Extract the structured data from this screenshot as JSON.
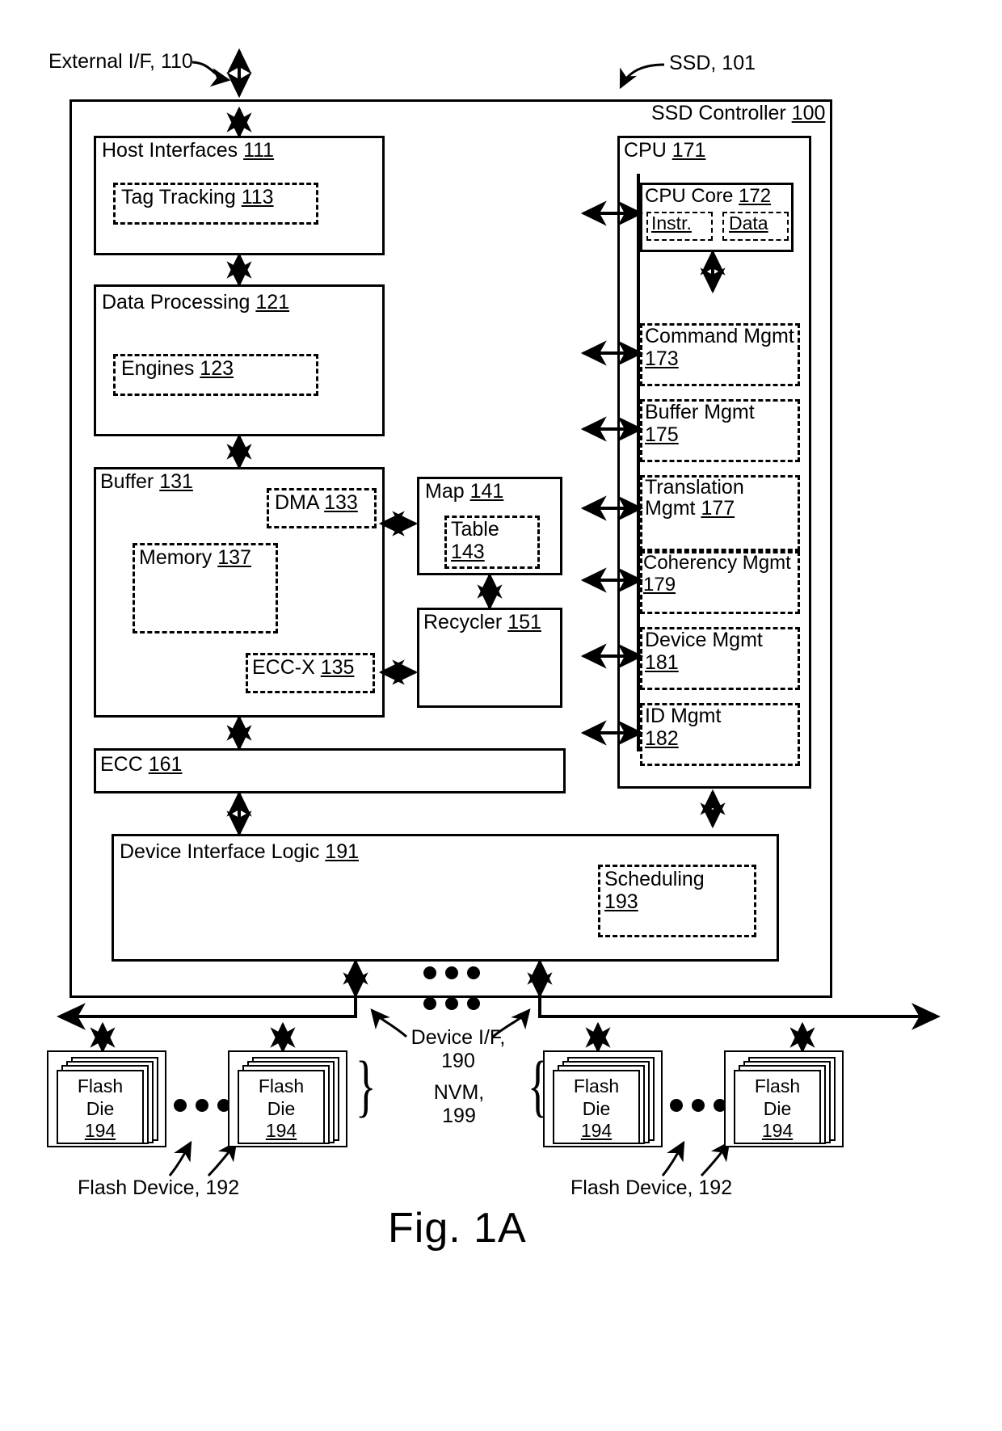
{
  "figure": {
    "caption": "Fig. 1A",
    "callouts": {
      "external_if": "External I/F, 110",
      "ssd": "SSD, 101",
      "device_if_line1": "Device I/F,",
      "device_if_line2": "190",
      "nvm_line1": "NVM,",
      "nvm_line2": "199",
      "flash_device_left": "Flash Device, 192",
      "flash_device_right": "Flash Device, 192"
    }
  },
  "controller": {
    "title_text": "SSD Controller ",
    "title_num": "100"
  },
  "left_column": {
    "host_interfaces": {
      "text": "Host Interfaces ",
      "num": "111"
    },
    "tag_tracking": {
      "text": "Tag Tracking ",
      "num": "113"
    },
    "data_processing": {
      "text": "Data Processing ",
      "num": "121"
    },
    "engines": {
      "text": "Engines ",
      "num": "123"
    },
    "buffer": {
      "text": "Buffer ",
      "num": "131"
    },
    "dma": {
      "text": "DMA ",
      "num": "133"
    },
    "memory": {
      "text": "Memory ",
      "num": "137"
    },
    "ecc_x": {
      "text": "ECC-X ",
      "num": "135"
    },
    "map": {
      "text": "Map ",
      "num": "141"
    },
    "table": {
      "text": "Table",
      "num": "143"
    },
    "recycler": {
      "text": "Recycler ",
      "num": "151"
    },
    "ecc": {
      "text": "ECC ",
      "num": "161"
    },
    "device_interface_logic": {
      "text": "Device Interface Logic ",
      "num": "191"
    },
    "scheduling": {
      "text": "Scheduling",
      "num": "193"
    }
  },
  "cpu": {
    "title": {
      "text": "CPU ",
      "num": "171"
    },
    "core": {
      "text": "CPU Core ",
      "num": "172"
    },
    "core_instr": "Instr.",
    "core_data": "Data",
    "modules": [
      {
        "name": "Command Mgmt",
        "num": "173"
      },
      {
        "name": "Buffer Mgmt",
        "num": "175"
      },
      {
        "name": "Translation Mgmt",
        "num": "177"
      },
      {
        "name": "Coherency Mgmt",
        "num": "179"
      },
      {
        "name": "Device Mgmt",
        "num": "181"
      },
      {
        "name": "ID Mgmt",
        "num": "182"
      }
    ]
  },
  "nvm": {
    "die_label_line1": "Flash",
    "die_label_line2": "Die",
    "die_num": "194",
    "groups": [
      {
        "side": "left",
        "dies": 2
      },
      {
        "side": "right",
        "dies": 2
      }
    ]
  },
  "colors": {
    "stroke": "#000000",
    "background": "#ffffff"
  }
}
